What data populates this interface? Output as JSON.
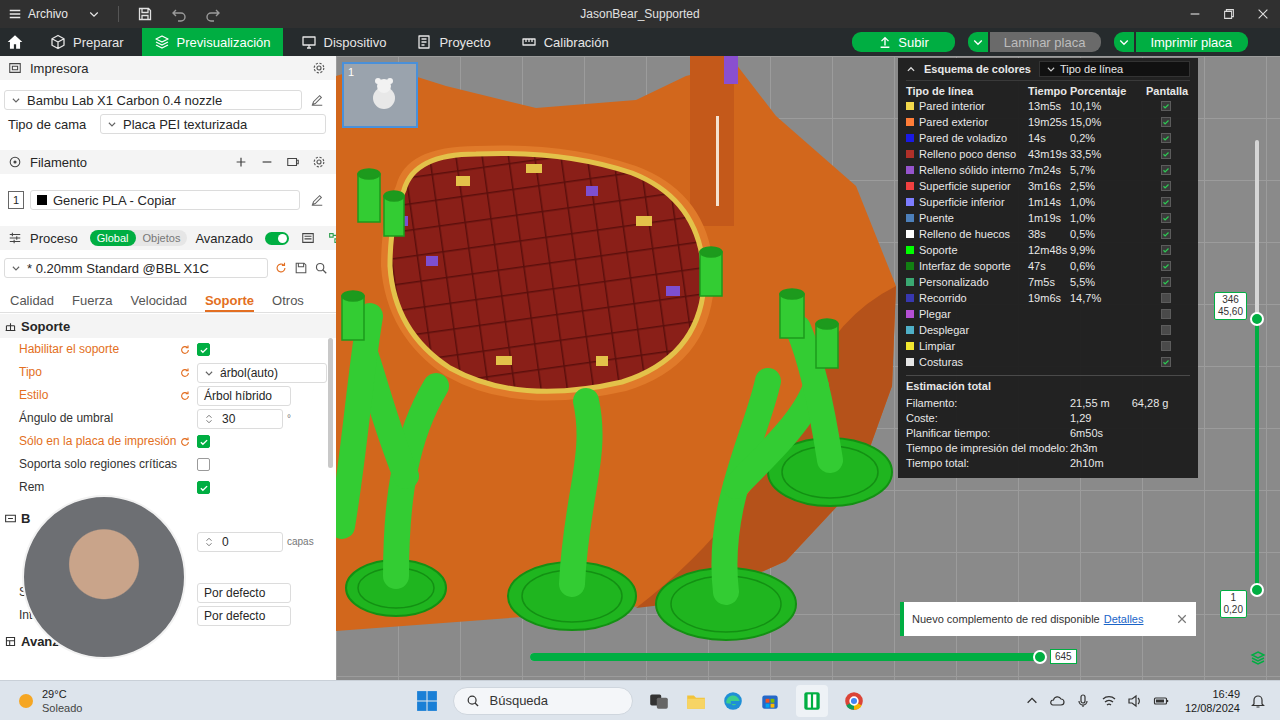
{
  "window": {
    "menu": "Archivo",
    "title": "JasonBear_Supported"
  },
  "tabs": [
    {
      "label": "Preparar",
      "selected": false
    },
    {
      "label": "Previsualización",
      "selected": true
    },
    {
      "label": "Dispositivo",
      "selected": false
    },
    {
      "label": "Proyecto",
      "selected": false
    },
    {
      "label": "Calibración",
      "selected": false
    }
  ],
  "actions": [
    {
      "label": "Subir",
      "kind": "button",
      "disabled": false
    },
    {
      "label": "Laminar placa",
      "kind": "split",
      "disabled": true
    },
    {
      "label": "Imprimir placa",
      "kind": "split",
      "disabled": false
    }
  ],
  "printer": {
    "title": "Impresora",
    "model": "Bambu Lab X1 Carbon 0.4 nozzle",
    "bed_label": "Tipo de cama",
    "bed": "Placa PEI texturizada"
  },
  "filament": {
    "title": "Filamento",
    "items": [
      {
        "index": "1",
        "name": "Generic PLA - Copiar",
        "color": "#000000"
      }
    ]
  },
  "process": {
    "title": "Proceso",
    "scopes": [
      {
        "label": "Global",
        "selected": true
      },
      {
        "label": "Objetos",
        "selected": false
      }
    ],
    "advanced": {
      "label": "Avanzado",
      "on": true
    },
    "preset": "* 0.20mm Standard @BBL X1C"
  },
  "setting_tabs": [
    {
      "label": "Calidad",
      "selected": false
    },
    {
      "label": "Fuerza",
      "selected": false
    },
    {
      "label": "Velocidad",
      "selected": false
    },
    {
      "label": "Soporte",
      "selected": true
    },
    {
      "label": "Otros",
      "selected": false
    }
  ],
  "sections": [
    {
      "title": "Soporte",
      "rows": [
        {
          "label": "Habilitar el soporte",
          "kind": "check",
          "modified": true,
          "checked": true,
          "value": "",
          "unit": ""
        },
        {
          "label": "Tipo",
          "kind": "select",
          "modified": true,
          "checked": false,
          "value": "árbol(auto)",
          "unit": ""
        },
        {
          "label": "Estilo",
          "kind": "text",
          "modified": true,
          "checked": false,
          "value": "Árbol híbrido",
          "unit": ""
        },
        {
          "label": "Ángulo de umbral",
          "kind": "spin",
          "modified": false,
          "checked": false,
          "value": "30",
          "unit": "°"
        },
        {
          "label": "Sólo en la placa de impresión",
          "kind": "check",
          "modified": true,
          "checked": true,
          "value": "",
          "unit": ""
        },
        {
          "label": "Soporta solo regiones críticas",
          "kind": "check",
          "modified": false,
          "checked": false,
          "value": "",
          "unit": ""
        },
        {
          "label": "Rem",
          "kind": "check",
          "modified": false,
          "checked": true,
          "value": "",
          "unit": ""
        }
      ]
    },
    {
      "title": "B",
      "rows": [
        {
          "label": "",
          "kind": "spin",
          "modified": false,
          "checked": false,
          "value": "0",
          "unit": "capas"
        },
        {
          "label": "S",
          "kind": "text",
          "modified": false,
          "checked": false,
          "value": "Por defecto",
          "unit": ""
        },
        {
          "label": "Inter",
          "kind": "text",
          "modified": false,
          "checked": false,
          "value": "Por defecto",
          "unit": ""
        }
      ]
    },
    {
      "title": "Avanzado",
      "rows": []
    }
  ],
  "viewport": {
    "plate": "1"
  },
  "legend": {
    "title": "Esquema de colores",
    "mode": "Tipo de línea",
    "columns": [
      "Tipo de línea",
      "Tiempo",
      "Porcentaje",
      "Pantalla"
    ],
    "rows": [
      {
        "name": "Pared interior",
        "time": "13m5s",
        "percent": "10,1%",
        "color": "#f2d84c",
        "shown": true
      },
      {
        "name": "Pared exterior",
        "time": "19m25s",
        "percent": "15,0%",
        "color": "#ff7d38",
        "shown": true
      },
      {
        "name": "Pared de voladizo",
        "time": "14s",
        "percent": "0,2%",
        "color": "#1a1ae6",
        "shown": true
      },
      {
        "name": "Relleno poco denso",
        "time": "43m19s",
        "percent": "33,5%",
        "color": "#b03029",
        "shown": true
      },
      {
        "name": "Relleno sólido interno",
        "time": "7m24s",
        "percent": "5,7%",
        "color": "#9654cc",
        "shown": true
      },
      {
        "name": "Superficie superior",
        "time": "3m16s",
        "percent": "2,5%",
        "color": "#f04040",
        "shown": true
      },
      {
        "name": "Superficie inferior",
        "time": "1m14s",
        "percent": "1,0%",
        "color": "#7d7dff",
        "shown": true
      },
      {
        "name": "Puente",
        "time": "1m19s",
        "percent": "1,0%",
        "color": "#4d80ba",
        "shown": true
      },
      {
        "name": "Relleno de huecos",
        "time": "38s",
        "percent": "0,5%",
        "color": "#ffffff",
        "shown": true
      },
      {
        "name": "Soporte",
        "time": "12m48s",
        "percent": "9,9%",
        "color": "#00ff00",
        "shown": true
      },
      {
        "name": "Interfaz de soporte",
        "time": "47s",
        "percent": "0,6%",
        "color": "#128012",
        "shown": true
      },
      {
        "name": "Personalizado",
        "time": "7m5s",
        "percent": "5,5%",
        "color": "#3aa872",
        "shown": true
      },
      {
        "name": "Recorrido",
        "time": "19m6s",
        "percent": "14,7%",
        "color": "#3838b0",
        "shown": false
      },
      {
        "name": "Plegar",
        "time": "",
        "percent": "",
        "color": "#b44fd4",
        "shown": false
      },
      {
        "name": "Desplegar",
        "time": "",
        "percent": "",
        "color": "#4fb0c8",
        "shown": false
      },
      {
        "name": "Limpiar",
        "time": "",
        "percent": "",
        "color": "#f0e630",
        "shown": false
      },
      {
        "name": "Costuras",
        "time": "",
        "percent": "",
        "color": "#e6e6e6",
        "shown": true
      }
    ]
  },
  "estimate": {
    "title": "Estimación total",
    "rows": [
      {
        "label": "Filamento:",
        "values": [
          "21,55 m",
          "64,28 g"
        ]
      },
      {
        "label": "Coste:",
        "values": [
          "1,29"
        ]
      },
      {
        "label": "Planificar tiempo:",
        "values": [
          "6m50s"
        ]
      },
      {
        "label": "Tiempo de impresión del modelo:",
        "values": [
          "2h3m"
        ]
      },
      {
        "label": "Tiempo total:",
        "values": [
          "2h10m"
        ]
      }
    ]
  },
  "layer_slider": {
    "top": [
      "346",
      "45,60"
    ],
    "bottom": [
      "1",
      "0,20"
    ],
    "level": 0.6
  },
  "move_slider": {
    "value": "645",
    "level": 1
  },
  "notice": {
    "text": "Nuevo complemento de red disponible",
    "link": "Detalles"
  },
  "taskbar": {
    "weather": {
      "temp": "29°C",
      "condition": "Soleado"
    },
    "search": "Búsqueda",
    "time": "16:49",
    "date": "12/08/2024"
  }
}
